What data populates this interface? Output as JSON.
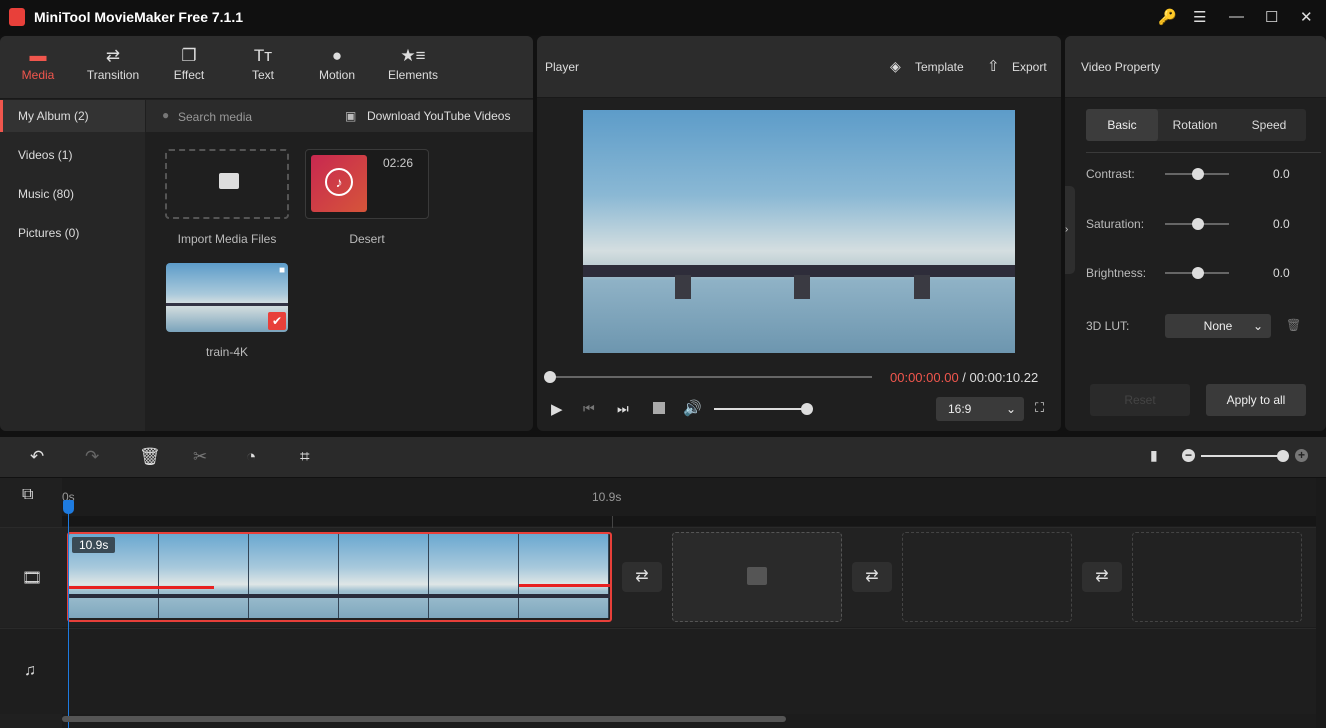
{
  "app": {
    "title": "MiniTool MovieMaker Free 7.1.1",
    "logo_text": "M"
  },
  "window_controls": {
    "key": "🔑",
    "menu": "☰",
    "minimize": "—",
    "maximize": "☐",
    "close": "✕"
  },
  "toolbar": {
    "items": [
      {
        "label": "Media",
        "icon": "folder-icon",
        "glyph": "▬",
        "active": true
      },
      {
        "label": "Transition",
        "icon": "transition-icon",
        "glyph": "⇄"
      },
      {
        "label": "Effect",
        "icon": "effect-icon",
        "glyph": "❐"
      },
      {
        "label": "Text",
        "icon": "text-icon",
        "glyph": "Tт"
      },
      {
        "label": "Motion",
        "icon": "motion-icon",
        "glyph": "●"
      },
      {
        "label": "Elements",
        "icon": "elements-icon",
        "glyph": "★≡"
      }
    ]
  },
  "sidebar": {
    "items": [
      {
        "label": "My Album (2)",
        "active": true
      },
      {
        "label": "Videos (1)"
      },
      {
        "label": "Music (80)"
      },
      {
        "label": "Pictures (0)"
      }
    ]
  },
  "media": {
    "search_placeholder": "Search media",
    "download_label": "Download YouTube Videos",
    "items": [
      {
        "label": "Import Media Files"
      },
      {
        "label": "Desert",
        "duration": "02:26"
      },
      {
        "label": "train-4K"
      }
    ]
  },
  "player": {
    "title": "Player",
    "template_label": "Template",
    "export_label": "Export",
    "current_time": "00:00:00.00",
    "separator": " / ",
    "total_time": "00:00:10.22",
    "progress": 0,
    "volume": 1.0,
    "aspect_ratio": "16:9"
  },
  "property": {
    "title": "Video Property",
    "tabs": [
      {
        "label": "Basic",
        "active": true
      },
      {
        "label": "Rotation"
      },
      {
        "label": "Speed"
      }
    ],
    "sliders": [
      {
        "label": "Contrast:",
        "value": "0.0"
      },
      {
        "label": "Saturation:",
        "value": "0.0"
      },
      {
        "label": "Brightness:",
        "value": "0.0"
      }
    ],
    "lut_label": "3D LUT:",
    "lut_value": "None",
    "reset_label": "Reset",
    "apply_label": "Apply to all"
  },
  "timeline": {
    "ruler": {
      "start": "0s",
      "mark": "10.9s"
    },
    "clip_duration": "10.9s",
    "zoom_level": 1.0
  },
  "colors": {
    "accent": "#f0564d",
    "playhead": "#1e7be0",
    "clip_border": "#e8403a"
  }
}
